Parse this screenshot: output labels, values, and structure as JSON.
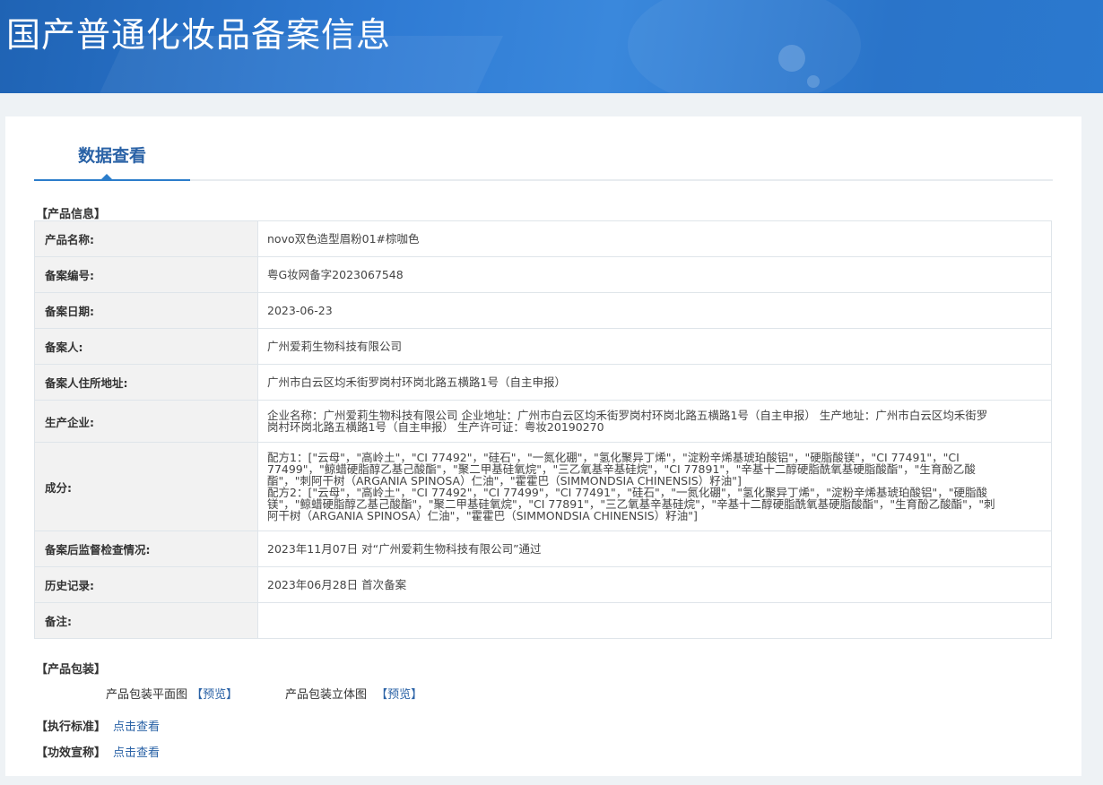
{
  "header": {
    "title": "国产普通化妆品备案信息"
  },
  "tab": {
    "label": "数据查看"
  },
  "product_info": {
    "section_title": "【产品信息】",
    "rows": [
      {
        "label": "产品名称:",
        "value": "novo双色造型眉粉01#棕咖色"
      },
      {
        "label": "备案编号:",
        "value": "粤G妆网备字2023067548"
      },
      {
        "label": "备案日期:",
        "value": "2023-06-23"
      },
      {
        "label": "备案人:",
        "value": "广州爱莉生物科技有限公司"
      },
      {
        "label": "备案人住所地址:",
        "value": "广州市白云区均禾街罗岗村环岗北路五横路1号（自主申报）"
      },
      {
        "label": "生产企业:",
        "value": "企业名称：广州爱莉生物科技有限公司 企业地址：广州市白云区均禾街罗岗村环岗北路五横路1号（自主申报） 生产地址：广州市白云区均禾街罗岗村环岗北路五横路1号（自主申报） 生产许可证：粤妆20190270"
      },
      {
        "label": "成分:",
        "value": "配方1：[\"云母\"，\"高岭土\"，\"CI 77492\"，\"硅石\"，\"一氮化硼\"，\"氢化聚异丁烯\"，\"淀粉辛烯基琥珀酸铝\"，\"硬脂酸镁\"，\"CI 77491\"，\"CI 77499\"，\"鲸蜡硬脂醇乙基己酸酯\"，\"聚二甲基硅氧烷\"，\"三乙氧基辛基硅烷\"，\"CI 77891\"，\"辛基十二醇硬脂酰氧基硬脂酸酯\"，\"生育酚乙酸酯\"，\"刺阿干树（ARGANIA SPINOSA）仁油\"，\"霍霍巴（SIMMONDSIA CHINENSIS）籽油\"]\n配方2：[\"云母\"，\"高岭土\"，\"CI 77492\"，\"CI 77499\"，\"CI 77491\"，\"硅石\"，\"一氮化硼\"，\"氢化聚异丁烯\"，\"淀粉辛烯基琥珀酸铝\"，\"硬脂酸镁\"，\"鲸蜡硬脂醇乙基己酸酯\"，\"聚二甲基硅氧烷\"，\"CI 77891\"，\"三乙氧基辛基硅烷\"，\"辛基十二醇硬脂酰氧基硬脂酸酯\"，\"生育酚乙酸酯\"，\"刺阿干树（ARGANIA SPINOSA）仁油\"，\"霍霍巴（SIMMONDSIA CHINENSIS）籽油\"]"
      },
      {
        "label": "备案后监督检查情况:",
        "value": "2023年11月07日 对“广州爱莉生物科技有限公司”通过"
      },
      {
        "label": "历史记录:",
        "value": "2023年06月28日 首次备案"
      },
      {
        "label": "备注:",
        "value": ""
      }
    ]
  },
  "packaging": {
    "section_title": "【产品包装】",
    "flat_label": "产品包装平面图",
    "flat_link": "【预览】",
    "solid_label": "产品包装立体图",
    "solid_link": "【预览】"
  },
  "standard": {
    "label": "【执行标准】",
    "link": "点击查看"
  },
  "efficacy": {
    "label": "【功效宣称】",
    "link": "点击查看"
  },
  "colors": {
    "banner": "#2b79cf",
    "accent": "#2a62a6",
    "label_bg": "#f2f2f2",
    "table_border": "#a9c5e2"
  }
}
